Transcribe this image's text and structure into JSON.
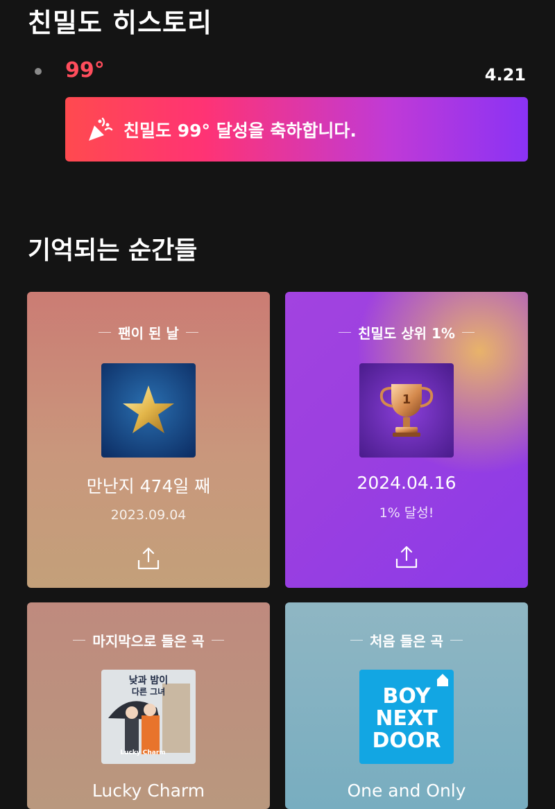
{
  "history": {
    "title": "친밀도 히스토리",
    "degree": "99°",
    "date": "4.21",
    "banner_text": "친밀도 99° 달성을 축하합니다."
  },
  "moments": {
    "title": "기억되는 순간들",
    "cards": [
      {
        "label": "팬이 된 날",
        "main": "만난지 474일 째",
        "sub": "2023.09.04",
        "icon": "star-icon"
      },
      {
        "label": "친밀도 상위 1%",
        "main": "2024.04.16",
        "sub": "1% 달성!",
        "icon": "trophy-icon"
      },
      {
        "label": "마지막으로 들은 곡",
        "main": "Lucky Charm",
        "icon": "album-art-icon",
        "album_text": {
          "title_line1": "낮과 밤이",
          "title_line2": "다른 그녀",
          "song": "Lucky Charm"
        }
      },
      {
        "label": "처음 들은 곡",
        "main": "One and Only",
        "icon": "boynextdoor-logo-icon",
        "logo_text": {
          "line1": "BOY",
          "line2": "NEXT",
          "line3": "DOOR"
        }
      }
    ]
  },
  "colors": {
    "degree": "#ff4d5c",
    "banner_start": "#ff4a4f",
    "banner_end": "#8a33f5",
    "background": "#141414"
  }
}
